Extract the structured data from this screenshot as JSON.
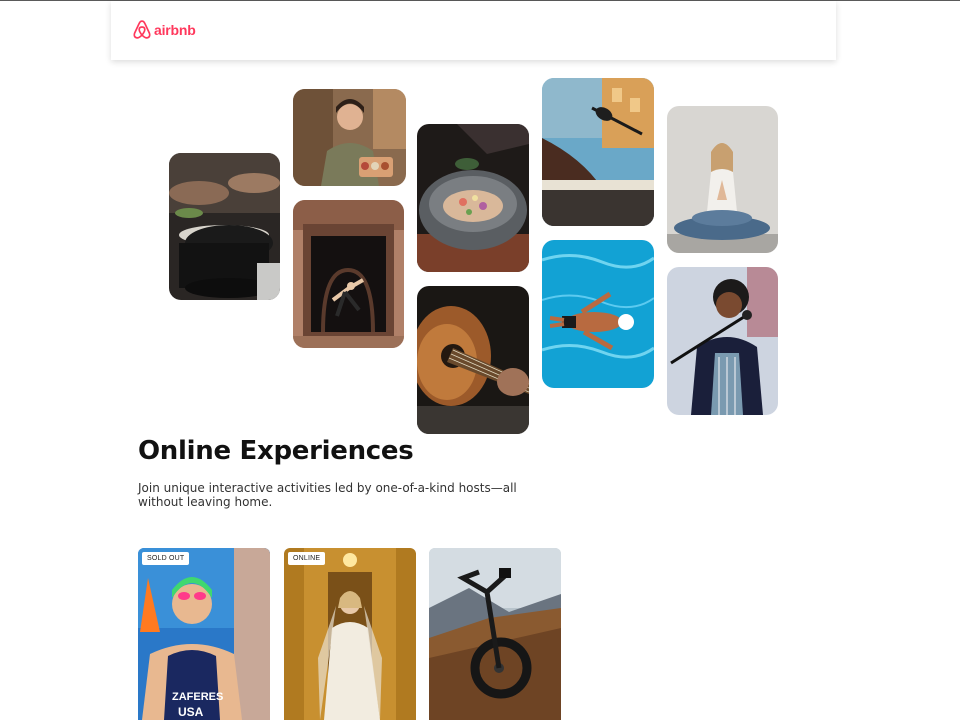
{
  "brand": {
    "name": "airbnb",
    "color": "#ff385c",
    "icon": "airbnb-logo-icon"
  },
  "hero": {
    "tiles": [
      {
        "name": "cooking-pans-photo"
      },
      {
        "name": "food-vendor-woman-photo"
      },
      {
        "name": "dancer-doorway-photo"
      },
      {
        "name": "gourmet-bowl-photo"
      },
      {
        "name": "guitar-player-photo"
      },
      {
        "name": "keyboard-mic-photo"
      },
      {
        "name": "swimmer-pool-photo"
      },
      {
        "name": "yoga-meditation-photo"
      },
      {
        "name": "singer-mic-photo"
      }
    ]
  },
  "section": {
    "title": "Online Experiences",
    "subtitle": "Join unique interactive activities led by one-of-a-kind hosts—all without leaving home."
  },
  "cards": [
    {
      "badge": "SOLD OUT",
      "image": "triathlete-photo"
    },
    {
      "badge": "ONLINE",
      "image": "bride-photo"
    },
    {
      "badge": "",
      "image": "mountain-bike-photo"
    }
  ]
}
